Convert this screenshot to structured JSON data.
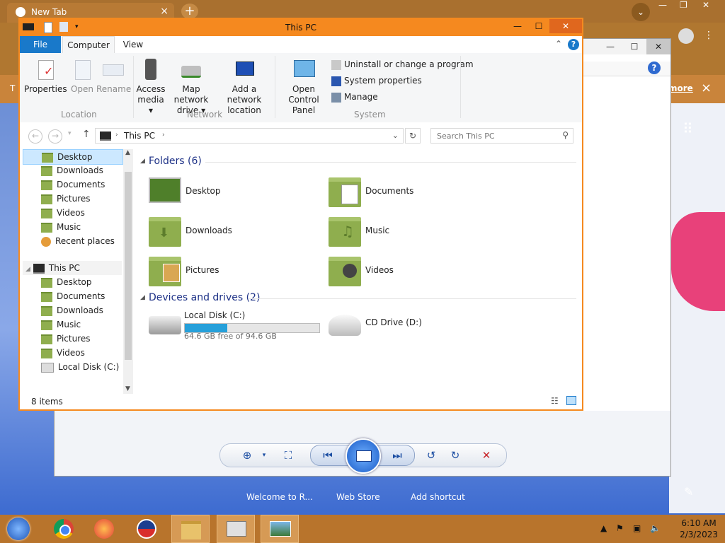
{
  "browser": {
    "tab_title": "New Tab",
    "tab_close": "×",
    "new_tab": "+",
    "bar_text": "T",
    "more_link": "more",
    "bar_close": "×",
    "ntp_tiles": [
      "Welcome to R...",
      "Web Store",
      "Add shortcut"
    ]
  },
  "explorer": {
    "title": "This PC",
    "menu": {
      "file": "File",
      "computer": "Computer",
      "view": "View"
    },
    "ribbon": {
      "location": {
        "label": "Location",
        "items": [
          "Properties",
          "Open",
          "Rename"
        ]
      },
      "network": {
        "label": "Network",
        "items": [
          "Access media ▾",
          "Map network drive ▾",
          "Add a network location"
        ]
      },
      "system": {
        "label": "System",
        "big": "Open Control Panel",
        "small": [
          "Uninstall or change a program",
          "System properties",
          "Manage"
        ]
      }
    },
    "address": {
      "path": "This PC",
      "search_placeholder": "Search This PC"
    },
    "nav": {
      "quick": [
        "Desktop",
        "Downloads",
        "Documents",
        "Pictures",
        "Videos",
        "Music",
        "Recent places"
      ],
      "this_pc": "This PC",
      "pc_items": [
        "Desktop",
        "Documents",
        "Downloads",
        "Music",
        "Pictures",
        "Videos",
        "Local Disk (C:)"
      ]
    },
    "folders_header": "Folders (6)",
    "folders": [
      "Desktop",
      "Documents",
      "Downloads",
      "Music",
      "Pictures",
      "Videos"
    ],
    "devices_header": "Devices and drives (2)",
    "drives": {
      "local_name": "Local Disk (C:)",
      "local_free": "64.6 GB free of 94.6 GB",
      "used_fraction": 0.317,
      "cd_name": "CD Drive (D:)"
    },
    "status": "8 items",
    "accent": "#f5891f"
  },
  "taskbar": {
    "time": "6:10 AM",
    "date": "2/3/2023",
    "apps": [
      "start-icon",
      "chrome-icon",
      "firefox-icon",
      "obama-logo-icon",
      "file-explorer-icon",
      "control-panel-icon",
      "photo-viewer-icon"
    ]
  }
}
